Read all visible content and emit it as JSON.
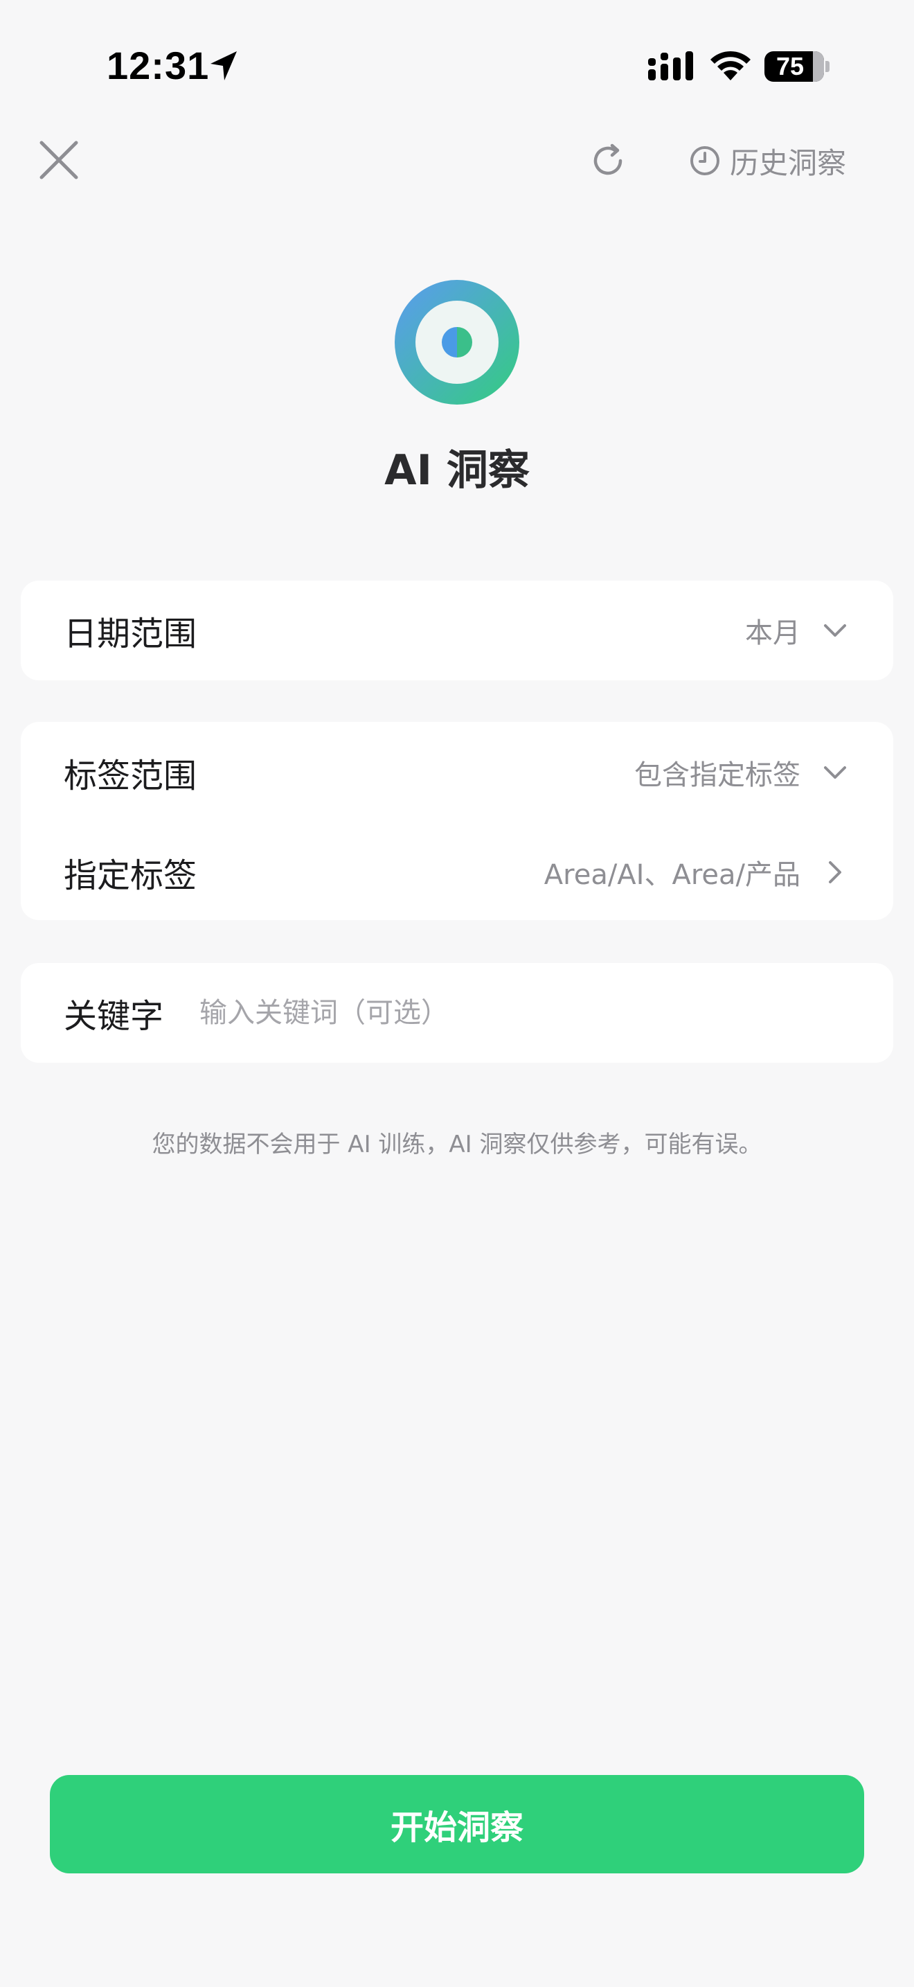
{
  "status_bar": {
    "time": "12:31",
    "battery": "75",
    "icons": [
      "location-arrow-icon",
      "cellular-signal-icon",
      "wifi-icon",
      "battery-icon"
    ]
  },
  "nav": {
    "close_icon": "close-icon",
    "refresh_icon": "refresh-icon",
    "history_icon": "clock-icon",
    "history_label": "历史洞察"
  },
  "header": {
    "logo_icon": "ai-insight-logo-icon",
    "title": "AI 洞察"
  },
  "form": {
    "date_range": {
      "label": "日期范围",
      "value": "本月"
    },
    "tag_range": {
      "label": "标签范围",
      "value": "包含指定标签"
    },
    "specified_tags": {
      "label": "指定标签",
      "value": "Area/AI、Area/产品"
    },
    "keyword": {
      "label": "关键字",
      "value": "",
      "placeholder": "输入关键词（可选）"
    }
  },
  "disclaimer": "您的数据不会用于 AI 训练，AI 洞察仅供参考，可能有误。",
  "action": {
    "start_label": "开始洞察"
  },
  "colors": {
    "accent": "#2fd07a",
    "background": "#f7f7f8",
    "card": "#ffffff",
    "secondary_text": "#8e8e93",
    "logo_gradient_start": "#5b9bf0",
    "logo_gradient_end": "#34cc80"
  }
}
